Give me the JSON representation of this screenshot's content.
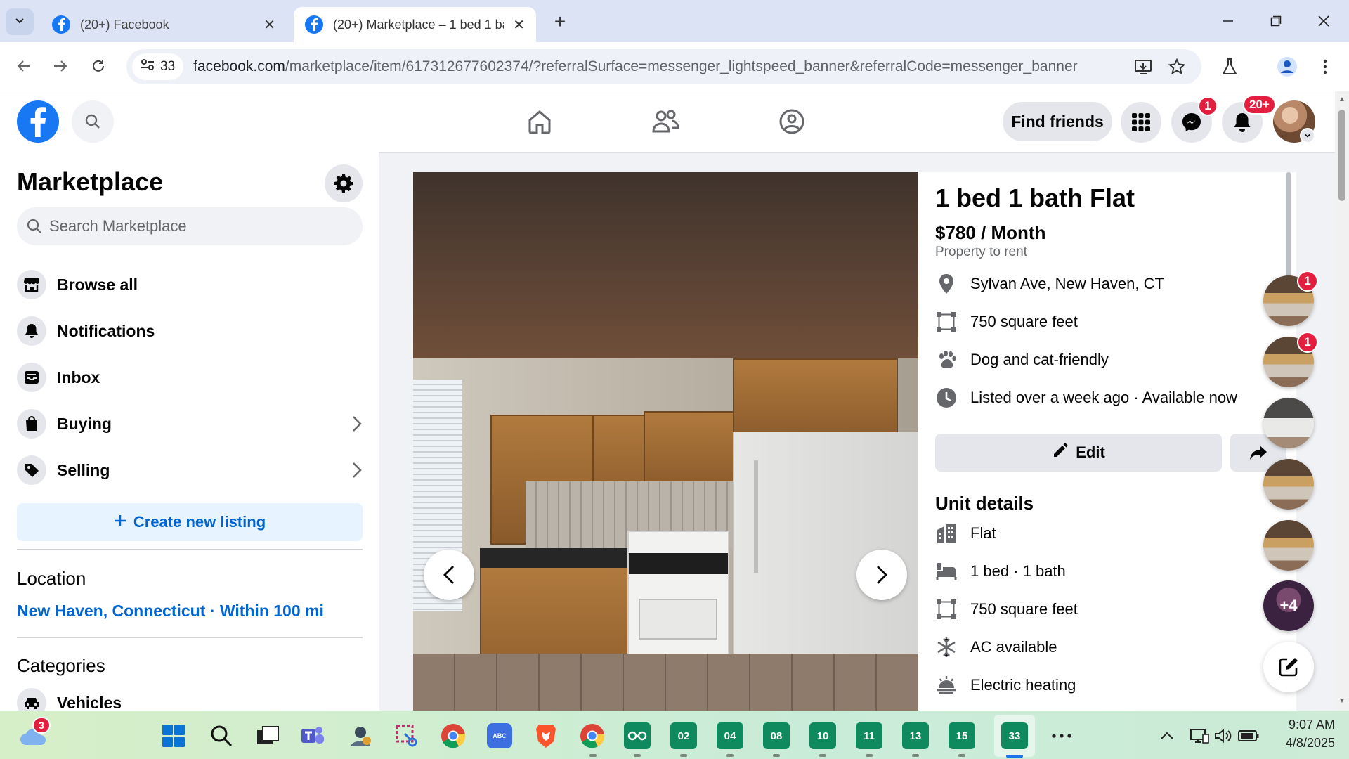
{
  "browser": {
    "tabs": [
      {
        "title": "(20+) Facebook",
        "active": false
      },
      {
        "title": "(20+) Marketplace – 1 bed 1 ba",
        "active": true
      }
    ],
    "site_info_count": "33",
    "url_host": "facebook.com",
    "url_rest": "/marketplace/item/617312677602374/?referralSurface=messenger_lightspeed_banner&referralCode=messenger_banner"
  },
  "fbnav": {
    "find_friends": "Find friends",
    "messenger_badge": "1",
    "notifications_badge": "20+"
  },
  "sidebar": {
    "title": "Marketplace",
    "search_placeholder": "Search Marketplace",
    "items": [
      {
        "label": "Browse all",
        "icon": "storefront-icon"
      },
      {
        "label": "Notifications",
        "icon": "bell-icon"
      },
      {
        "label": "Inbox",
        "icon": "inbox-icon"
      },
      {
        "label": "Buying",
        "icon": "shopping-bag-icon"
      },
      {
        "label": "Selling",
        "icon": "tag-icon"
      }
    ],
    "create_listing": "Create new listing",
    "location_heading": "Location",
    "location_value": "New Haven, Connecticut · Within 100 mi",
    "categories_heading": "Categories",
    "first_category": "Vehicles"
  },
  "listing": {
    "title": "1 bed 1 bath Flat",
    "price": "$780 / Month",
    "type": "Property to rent",
    "facts": [
      {
        "text": "Sylvan Ave, New Haven, CT",
        "icon": "location-pin-icon"
      },
      {
        "text": "750 square feet",
        "icon": "square-feet-icon"
      },
      {
        "text": "Dog and cat-friendly",
        "icon": "paw-icon"
      },
      {
        "text": "Listed over a week ago · Available now",
        "icon": "clock-icon"
      }
    ],
    "edit_label": "Edit",
    "unit_details_heading": "Unit details",
    "unit_details": [
      {
        "text": "Flat",
        "icon": "building-icon"
      },
      {
        "text": "1 bed · 1 bath",
        "icon": "bed-icon"
      },
      {
        "text": "750 square feet",
        "icon": "square-feet-icon"
      },
      {
        "text": "AC available",
        "icon": "snowflake-icon"
      },
      {
        "text": "Electric heating",
        "icon": "heating-icon"
      }
    ]
  },
  "chatheads": {
    "badges": [
      "1",
      "1"
    ],
    "more_count": "+4"
  },
  "taskbar": {
    "weather_badge": "3",
    "tiles": [
      "02",
      "04",
      "08",
      "10",
      "11",
      "13",
      "15",
      "33"
    ],
    "time": "9:07 AM",
    "date": "4/8/2025"
  },
  "colors": {
    "facebook_blue": "#1877f2",
    "link_blue": "#0064d1",
    "badge_red": "#e41e3f"
  }
}
